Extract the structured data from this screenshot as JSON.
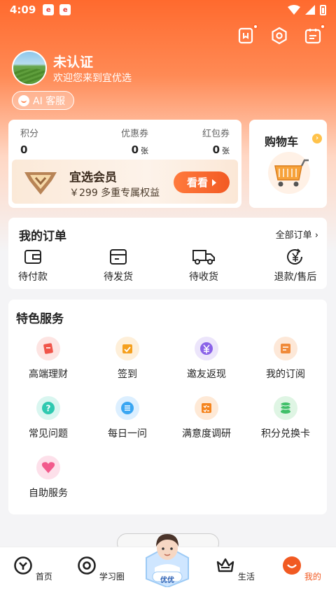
{
  "status_bar": {
    "time": "4:09"
  },
  "user": {
    "name": "未认证",
    "welcome": "欢迎您来到宜优选",
    "ai_service": "AI 客服"
  },
  "assets": {
    "points": {
      "label": "积分",
      "value": "0"
    },
    "coupons": {
      "label": "优惠券",
      "value": "0",
      "unit": "张"
    },
    "red_packets": {
      "label": "红包券",
      "value": "0",
      "unit": "张"
    }
  },
  "member": {
    "title": "宜选会员",
    "desc": "￥299 多重专属权益",
    "button": "看看"
  },
  "cart": {
    "title": "购物车"
  },
  "orders": {
    "title": "我的订单",
    "all": "全部订单",
    "items": [
      {
        "label": "待付款",
        "icon": "wallet-icon"
      },
      {
        "label": "待发货",
        "icon": "package-icon"
      },
      {
        "label": "待收货",
        "icon": "truck-icon"
      },
      {
        "label": "退款/售后",
        "icon": "refund-icon"
      }
    ]
  },
  "services": {
    "title": "特色服务",
    "items": [
      {
        "label": "高端理财",
        "icon": "finance-icon",
        "color": "#f0554a",
        "bg": "#fde4e2"
      },
      {
        "label": "签到",
        "icon": "calendar-icon",
        "color": "#f5a01f",
        "bg": "#feefd9"
      },
      {
        "label": "邀友返现",
        "icon": "yen-icon",
        "color": "#8a62e8",
        "bg": "#ece5fb"
      },
      {
        "label": "我的订阅",
        "icon": "subscribe-icon",
        "color": "#f08a3a",
        "bg": "#fde8d8"
      },
      {
        "label": "常见问题",
        "icon": "question-icon",
        "color": "#2fc9b0",
        "bg": "#d9f6f0"
      },
      {
        "label": "每日一问",
        "icon": "daily-icon",
        "color": "#3aa6f2",
        "bg": "#dcefff"
      },
      {
        "label": "满意度调研",
        "icon": "survey-icon",
        "color": "#f5851f",
        "bg": "#fee9d6"
      },
      {
        "label": "积分兑换卡",
        "icon": "coins-icon",
        "color": "#3fbf68",
        "bg": "#dff5e4"
      },
      {
        "label": "自助服务",
        "icon": "heart-icon",
        "color": "#f25a8c",
        "bg": "#fde0ea"
      }
    ]
  },
  "tabbar": {
    "items": [
      {
        "label": "首页",
        "icon": "home-icon"
      },
      {
        "label": "学习圈",
        "icon": "target-icon"
      },
      {
        "label": "生活",
        "icon": "crown-icon"
      },
      {
        "label": "我的",
        "icon": "profile-icon"
      }
    ],
    "center_label": "优优",
    "active_color": "#f15a22"
  }
}
